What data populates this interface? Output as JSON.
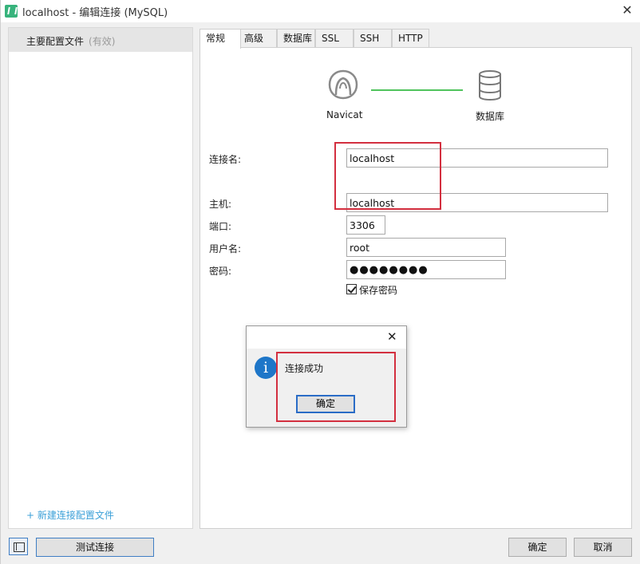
{
  "window": {
    "title": "localhost - 编辑连接 (MySQL)",
    "close_glyph": "✕"
  },
  "sidebar": {
    "profile": {
      "name": "主要配置文件",
      "state": "(有效)"
    },
    "new_profile_link": "+ 新建连接配置文件"
  },
  "tabs": [
    {
      "label": "常规",
      "active": true
    },
    {
      "label": "高级",
      "active": false
    },
    {
      "label": "数据库",
      "active": false
    },
    {
      "label": "SSL",
      "active": false
    },
    {
      "label": "SSH",
      "active": false
    },
    {
      "label": "HTTP",
      "active": false
    }
  ],
  "diagram": {
    "left_label": "Navicat",
    "right_label": "数据库",
    "line_color": "#4fc35c"
  },
  "form": {
    "connection_name": {
      "label": "连接名:",
      "value": "localhost"
    },
    "host": {
      "label": "主机:",
      "value": "localhost"
    },
    "port": {
      "label": "端口:",
      "value": "3306"
    },
    "username": {
      "label": "用户名:",
      "value": "root"
    },
    "password": {
      "label": "密码:",
      "value": "●●●●●●●●"
    },
    "save_password": {
      "label": "保存密码",
      "checked": true
    }
  },
  "dialog": {
    "message": "连接成功",
    "ok_label": "确定",
    "close_glyph": "✕",
    "info_glyph": "i"
  },
  "footer": {
    "test_button": "测试连接",
    "ok_button": "确定",
    "cancel_button": "取消"
  },
  "colors": {
    "annotation_red": "#d32f3f",
    "info_blue": "#1e76c8",
    "link_blue": "#3ba0d8"
  }
}
